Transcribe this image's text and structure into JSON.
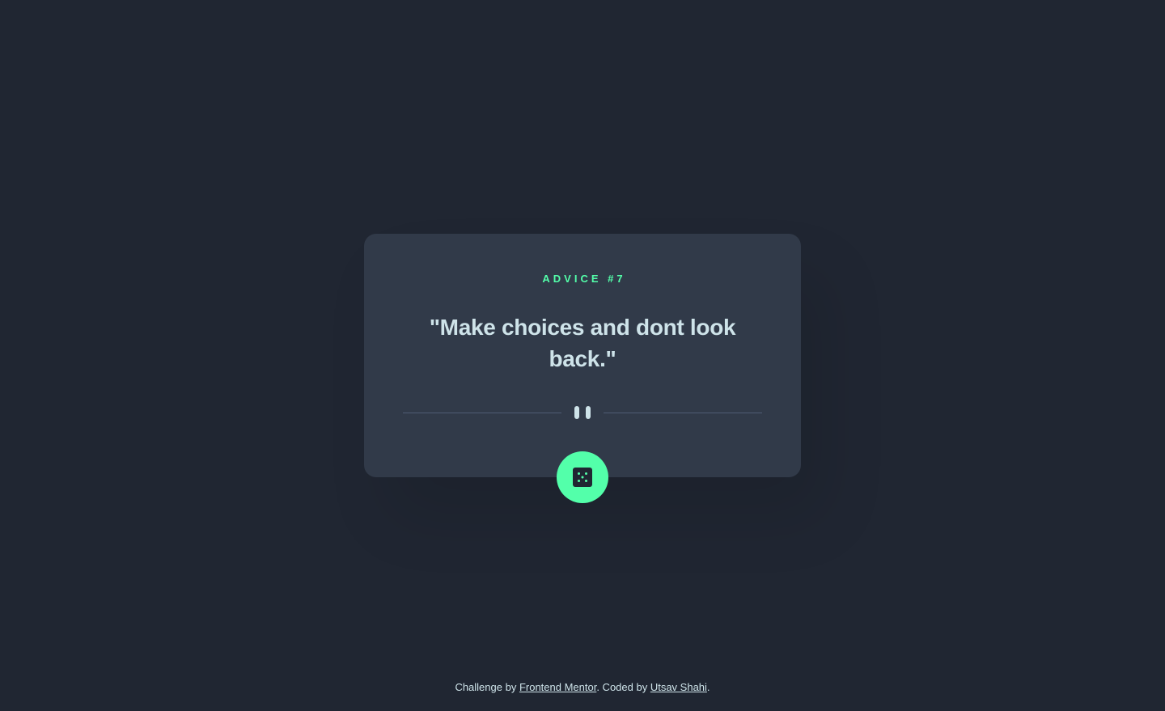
{
  "card": {
    "advice_id": "ADVICE #7",
    "advice_text": "\"Make choices and dont look back.\""
  },
  "dice_button": {
    "icon": "dice-icon"
  },
  "divider": {
    "icon": "pause-icon"
  },
  "footer": {
    "prefix": "Challenge by ",
    "challenge_link": "Frontend Mentor",
    "middle": ". Coded by ",
    "author_link": "Utsav Shahi",
    "suffix": "."
  },
  "colors": {
    "background": "#202632",
    "card": "#313a49",
    "accent": "#53ffaa",
    "text": "#cee3e9",
    "divider": "#4f5d74"
  }
}
